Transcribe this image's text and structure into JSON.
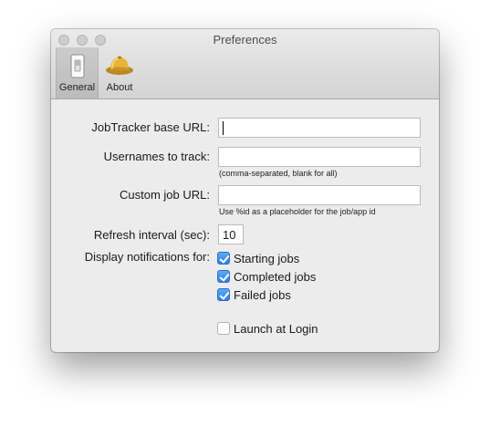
{
  "window": {
    "title": "Preferences"
  },
  "toolbar": {
    "general": {
      "label": "General",
      "icon": "switch-icon",
      "selected": true
    },
    "about": {
      "label": "About",
      "icon": "pith-helmet-icon"
    }
  },
  "form": {
    "jobtracker_url": {
      "label": "JobTracker base URL:",
      "value": ""
    },
    "usernames": {
      "label": "Usernames to track:",
      "value": "",
      "hint": "(comma-separated, blank for all)"
    },
    "custom_job_url": {
      "label": "Custom job URL:",
      "value": "",
      "hint": "Use %id as a placeholder for the job/app id"
    },
    "refresh": {
      "label": "Refresh interval (sec):",
      "value": "10"
    },
    "notifications": {
      "label": "Display notifications for:",
      "options": [
        {
          "label": "Starting jobs",
          "checked": true
        },
        {
          "label": "Completed jobs",
          "checked": true
        },
        {
          "label": "Failed jobs",
          "checked": true
        }
      ]
    },
    "launch_at_login": {
      "label": "Launch at Login",
      "checked": false
    }
  },
  "colors": {
    "accent": "#3b8df0",
    "window_bg": "#ececec",
    "titlebar": "#dcdcdc"
  }
}
